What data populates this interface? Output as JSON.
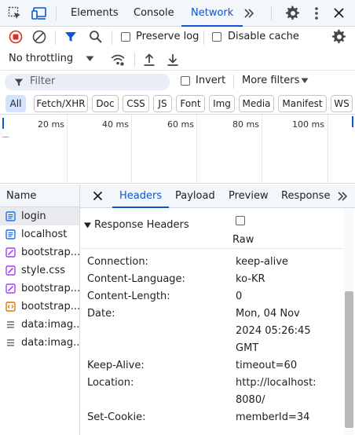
{
  "tabs": {
    "elements": "Elements",
    "console": "Console",
    "network": "Network"
  },
  "toolbar": {
    "preserve_log": "Preserve log",
    "disable_cache": "Disable cache",
    "throttling": "No throttling"
  },
  "filter": {
    "placeholder": "Filter",
    "invert": "Invert",
    "more_filters": "More filters"
  },
  "type_filters": [
    "All",
    "Fetch/XHR",
    "Doc",
    "CSS",
    "JS",
    "Font",
    "Img",
    "Media",
    "Manifest",
    "WS"
  ],
  "timeline": {
    "ticks": [
      "20 ms",
      "40 ms",
      "60 ms",
      "80 ms",
      "100 ms"
    ]
  },
  "requests": {
    "header": "Name",
    "items": [
      {
        "name": "login",
        "type": "doc"
      },
      {
        "name": "localhost",
        "type": "doc"
      },
      {
        "name": "bootstrap...",
        "type": "css"
      },
      {
        "name": "style.css",
        "type": "css"
      },
      {
        "name": "bootstrap...",
        "type": "css"
      },
      {
        "name": "bootstrap...",
        "type": "js"
      },
      {
        "name": "data:imag...",
        "type": "data"
      },
      {
        "name": "data:imag...",
        "type": "data"
      }
    ]
  },
  "detail": {
    "tabs": [
      "Headers",
      "Payload",
      "Preview",
      "Response"
    ],
    "section_title": "Response Headers",
    "raw_label": "Raw",
    "headers": [
      {
        "name": "Connection:",
        "value": [
          "keep-alive"
        ]
      },
      {
        "name": "Content-Language:",
        "value": [
          "ko-KR"
        ]
      },
      {
        "name": "Content-Length:",
        "value": [
          "0"
        ]
      },
      {
        "name": "Date:",
        "value": [
          "Mon, 04 Nov",
          "2024 05:26:45",
          "GMT"
        ]
      },
      {
        "name": "Keep-Alive:",
        "value": [
          "timeout=60"
        ]
      },
      {
        "name": "Location:",
        "value": [
          "http://localhost:",
          "8080/"
        ]
      },
      {
        "name": "Set-Cookie:",
        "value": [
          "memberId=34"
        ]
      }
    ]
  },
  "colors": {
    "accent": "#0b57d0",
    "record_red": "#d93025",
    "toolbar_bg": "#f3f6fb",
    "chip_active": "#d3e3fd",
    "css_icon": "#a142f4",
    "js_icon": "#e37400",
    "doc_icon": "#1a73e8"
  },
  "icons": [
    "inspect-icon",
    "device-toggle-icon",
    "more-tabs-icon",
    "settings-icon",
    "kebab-menu-icon",
    "close-icon",
    "record-stop-icon",
    "clear-icon",
    "filter-icon",
    "search-icon",
    "network-conditions-icon",
    "import-har-icon",
    "export-har-icon",
    "caret-down-icon"
  ]
}
